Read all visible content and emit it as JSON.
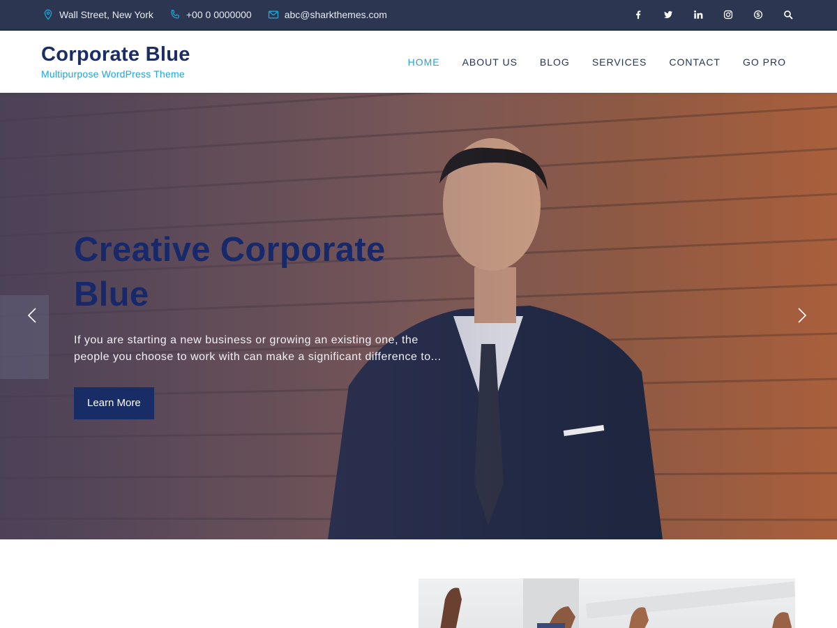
{
  "topbar": {
    "address": "Wall Street, New York",
    "phone": "+00 0 0000000",
    "email": "abc@sharkthemes.com",
    "social": [
      "facebook-icon",
      "twitter-icon",
      "linkedin-icon",
      "instagram-icon",
      "skype-icon",
      "search-icon"
    ]
  },
  "brand": {
    "title": "Corporate Blue",
    "subtitle": "Multipurpose WordPress Theme"
  },
  "nav": {
    "items": [
      "HOME",
      "ABOUT US",
      "BLOG",
      "SERVICES",
      "CONTACT",
      "GO PRO"
    ],
    "active": "HOME"
  },
  "hero": {
    "title_line1": "Creative Corporate",
    "title_line2": "Blue",
    "text_line1": "If you are starting a new business or growing an existing one, the",
    "text_line2": "people you choose to work with can make a significant difference to...",
    "button": "Learn More"
  },
  "colors": {
    "topbar_bg": "#2c3650",
    "brand_navy": "#1b2e63",
    "accent_blue": "#1ea5d9",
    "button_bg": "#182c66"
  }
}
